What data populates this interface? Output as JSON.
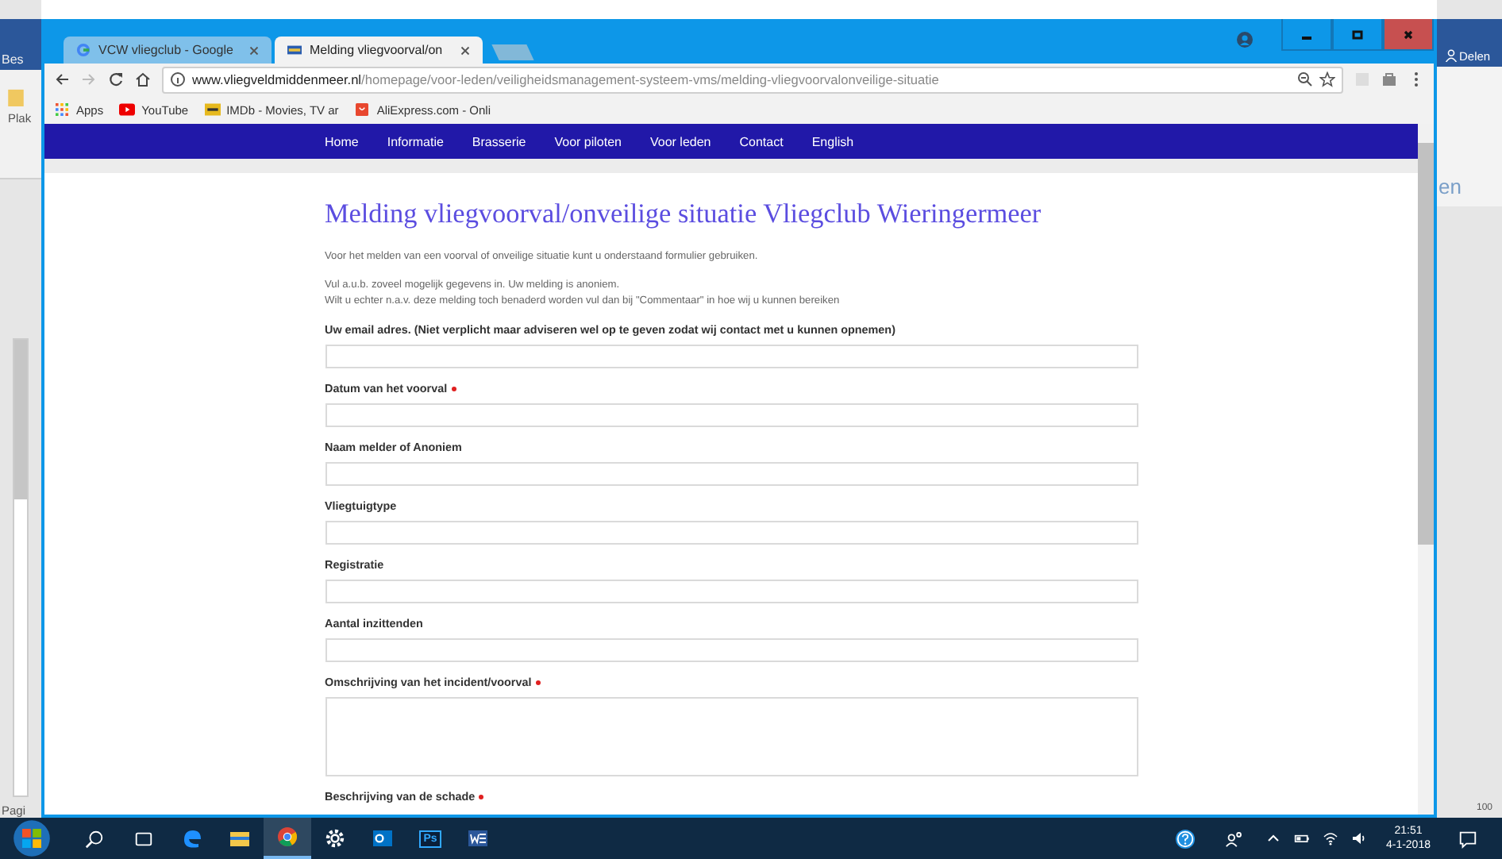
{
  "background_app": {
    "left_fragments": [
      "Bes",
      "Plak",
      "Pagi"
    ],
    "share_button": "Delen",
    "right_fragments": [
      "en",
      "100"
    ]
  },
  "browser": {
    "tabs": [
      {
        "title": "VCW vliegclub - Google",
        "selected": false
      },
      {
        "title": "Melding vliegvoorval/on",
        "selected": true
      }
    ],
    "url": {
      "domain": "www.vliegveldmiddenmeer.nl",
      "path": "/homepage/voor-leden/veiligheidsmanagement-systeem-vms/melding-vliegvoorvalonveilige-situatie"
    },
    "bookmarks": [
      "Apps",
      "YouTube",
      "IMDb - Movies, TV ar",
      "AliExpress.com - Onli"
    ]
  },
  "page": {
    "nav": [
      "Home",
      "Informatie",
      "Brasserie",
      "Voor piloten",
      "Voor leden",
      "Contact",
      "English"
    ],
    "title": "Melding vliegvoorval/onveilige situatie Vliegclub Wieringermeer",
    "intro": [
      "Voor het melden van een voorval of onveilige situatie kunt u onderstaand formulier gebruiken.",
      "Vul a.u.b. zoveel mogelijk gegevens in. Uw melding is anoniem.\nWilt u echter n.a.v. deze melding toch benaderd worden vul dan bij \"Commentaar\" in hoe wij u kunnen bereiken"
    ],
    "fields": [
      {
        "label": "Uw email adres. (Niet verplicht maar adviseren wel op te geven zodat wij contact met u kunnen opnemen)",
        "required": false,
        "kind": "text"
      },
      {
        "label": "Datum van het voorval",
        "required": true,
        "kind": "text"
      },
      {
        "label": "Naam melder of Anoniem",
        "required": false,
        "kind": "text"
      },
      {
        "label": "Vliegtuigtype",
        "required": false,
        "kind": "text"
      },
      {
        "label": "Registratie",
        "required": false,
        "kind": "text"
      },
      {
        "label": "Aantal inzittenden",
        "required": false,
        "kind": "text"
      },
      {
        "label": "Omschrijving van het incident/voorval",
        "required": true,
        "kind": "textarea"
      },
      {
        "label": "Beschrijving van de schade",
        "required": true,
        "kind": "cut"
      }
    ]
  },
  "taskbar": {
    "apps": [
      {
        "kind": "edge",
        "active": false
      },
      {
        "kind": "explorer",
        "active": false
      },
      {
        "kind": "chrome",
        "active": true
      },
      {
        "kind": "settings",
        "active": false
      },
      {
        "kind": "outlook",
        "active": false
      },
      {
        "kind": "photoshop",
        "active": false,
        "label": "Ps"
      },
      {
        "kind": "word",
        "active": false
      }
    ],
    "time": "21:51",
    "date": "4-1-2018"
  }
}
